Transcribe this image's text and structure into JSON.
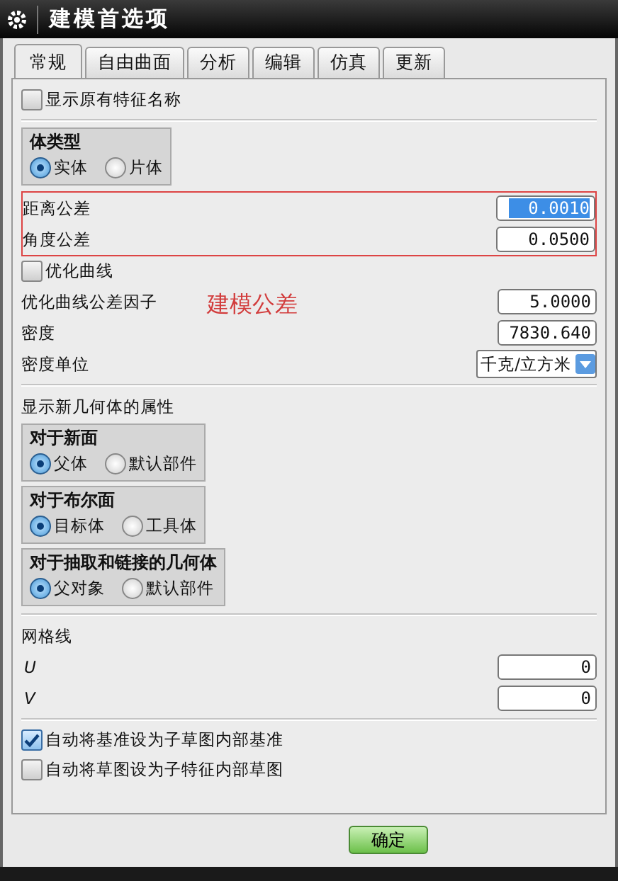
{
  "window": {
    "title": "建模首选项"
  },
  "tabs": [
    {
      "label": "常规",
      "selected": true
    },
    {
      "label": "自由曲面",
      "selected": false
    },
    {
      "label": "分析",
      "selected": false
    },
    {
      "label": "编辑",
      "selected": false
    },
    {
      "label": "仿真",
      "selected": false
    },
    {
      "label": "更新",
      "selected": false
    }
  ],
  "show_original_feature_names": {
    "label": "显示原有特征名称",
    "checked": false
  },
  "body_type": {
    "title": "体类型",
    "options": [
      {
        "label": "实体",
        "selected": true
      },
      {
        "label": "片体",
        "selected": false
      }
    ]
  },
  "tolerance_fields": [
    {
      "label": "距离公差",
      "value": "0.0010",
      "text_selected": true
    },
    {
      "label": "角度公差",
      "value": "0.0500",
      "text_selected": false
    }
  ],
  "optimize_curves": {
    "label": "优化曲线",
    "checked": false
  },
  "fields": [
    {
      "label": "优化曲线公差因子",
      "value": "5.0000"
    },
    {
      "label": "密度",
      "value": "7830.640"
    }
  ],
  "density_unit": {
    "label": "密度单位",
    "value": "千克/立方米"
  },
  "annotation": {
    "text": "建模公差"
  },
  "new_geometry": {
    "title": "显示新几何体的属性",
    "groups": [
      {
        "title": "对于新面",
        "options": [
          {
            "label": "父体",
            "selected": true
          },
          {
            "label": "默认部件",
            "selected": false
          }
        ]
      },
      {
        "title": "对于布尔面",
        "options": [
          {
            "label": "目标体",
            "selected": true
          },
          {
            "label": "工具体",
            "selected": false
          }
        ]
      },
      {
        "title": "对于抽取和链接的几何体",
        "options": [
          {
            "label": "父对象",
            "selected": true
          },
          {
            "label": "默认部件",
            "selected": false
          }
        ]
      }
    ]
  },
  "grid_lines": {
    "title": "网格线",
    "fields": [
      {
        "label": "U",
        "value": "0"
      },
      {
        "label": "V",
        "value": "0"
      }
    ]
  },
  "checkboxes": [
    {
      "label": "自动将基准设为子草图内部基准",
      "checked": true
    },
    {
      "label": "自动将草图设为子特征内部草图",
      "checked": false
    }
  ],
  "buttons": [
    "确定"
  ]
}
